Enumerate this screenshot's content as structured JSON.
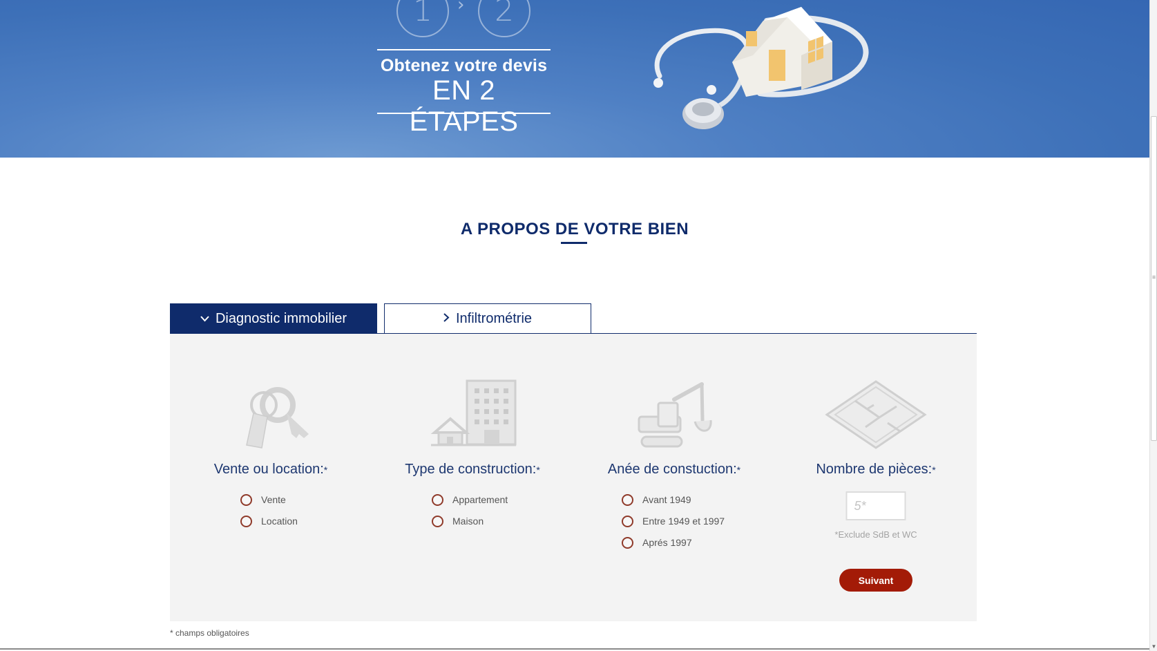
{
  "hero": {
    "step_one": "1",
    "step_arrow": "›",
    "step_two": "2",
    "title_line1": "Obtenez votre devis",
    "title_line2": "EN 2 ÉTAPES",
    "image": "house-with-stethoscope-illustration"
  },
  "section": {
    "title": "A PROPOS DE VOTRE BIEN"
  },
  "tabs": [
    {
      "label": "Diagnostic immobilier",
      "icon": "chevron-down-icon",
      "active": true
    },
    {
      "label": "Infiltrométrie",
      "icon": "chevron-right-icon",
      "active": false
    }
  ],
  "form": {
    "sale_or_rent": {
      "icon": "keys-icon",
      "label": "Vente ou location:",
      "required_mark": "*",
      "options": [
        "Vente",
        "Location"
      ]
    },
    "construction_type": {
      "icon": "building-icon",
      "label": "Type de construction:",
      "required_mark": "*",
      "options": [
        "Appartement",
        "Maison"
      ]
    },
    "construction_year": {
      "icon": "excavator-icon",
      "label": "Anée de constuction:",
      "required_mark": "*",
      "options": [
        "Avant 1949",
        "Entre 1949 et 1997",
        "Aprés 1997"
      ]
    },
    "rooms": {
      "icon": "floor-plan-icon",
      "label": "Nombre de pièces:",
      "required_mark": "*",
      "placeholder": "5*",
      "value": "",
      "note": "*Exclude SdB et WC"
    },
    "next_button": "Suivant"
  },
  "footnote": "* champs obligatoires",
  "colors": {
    "navy": "#0f2b6b",
    "hero_blue": "#3d70b8",
    "button_red": "#a31b07",
    "radio_border": "#8f3a2a",
    "panel_bg": "#f3f3f3"
  }
}
